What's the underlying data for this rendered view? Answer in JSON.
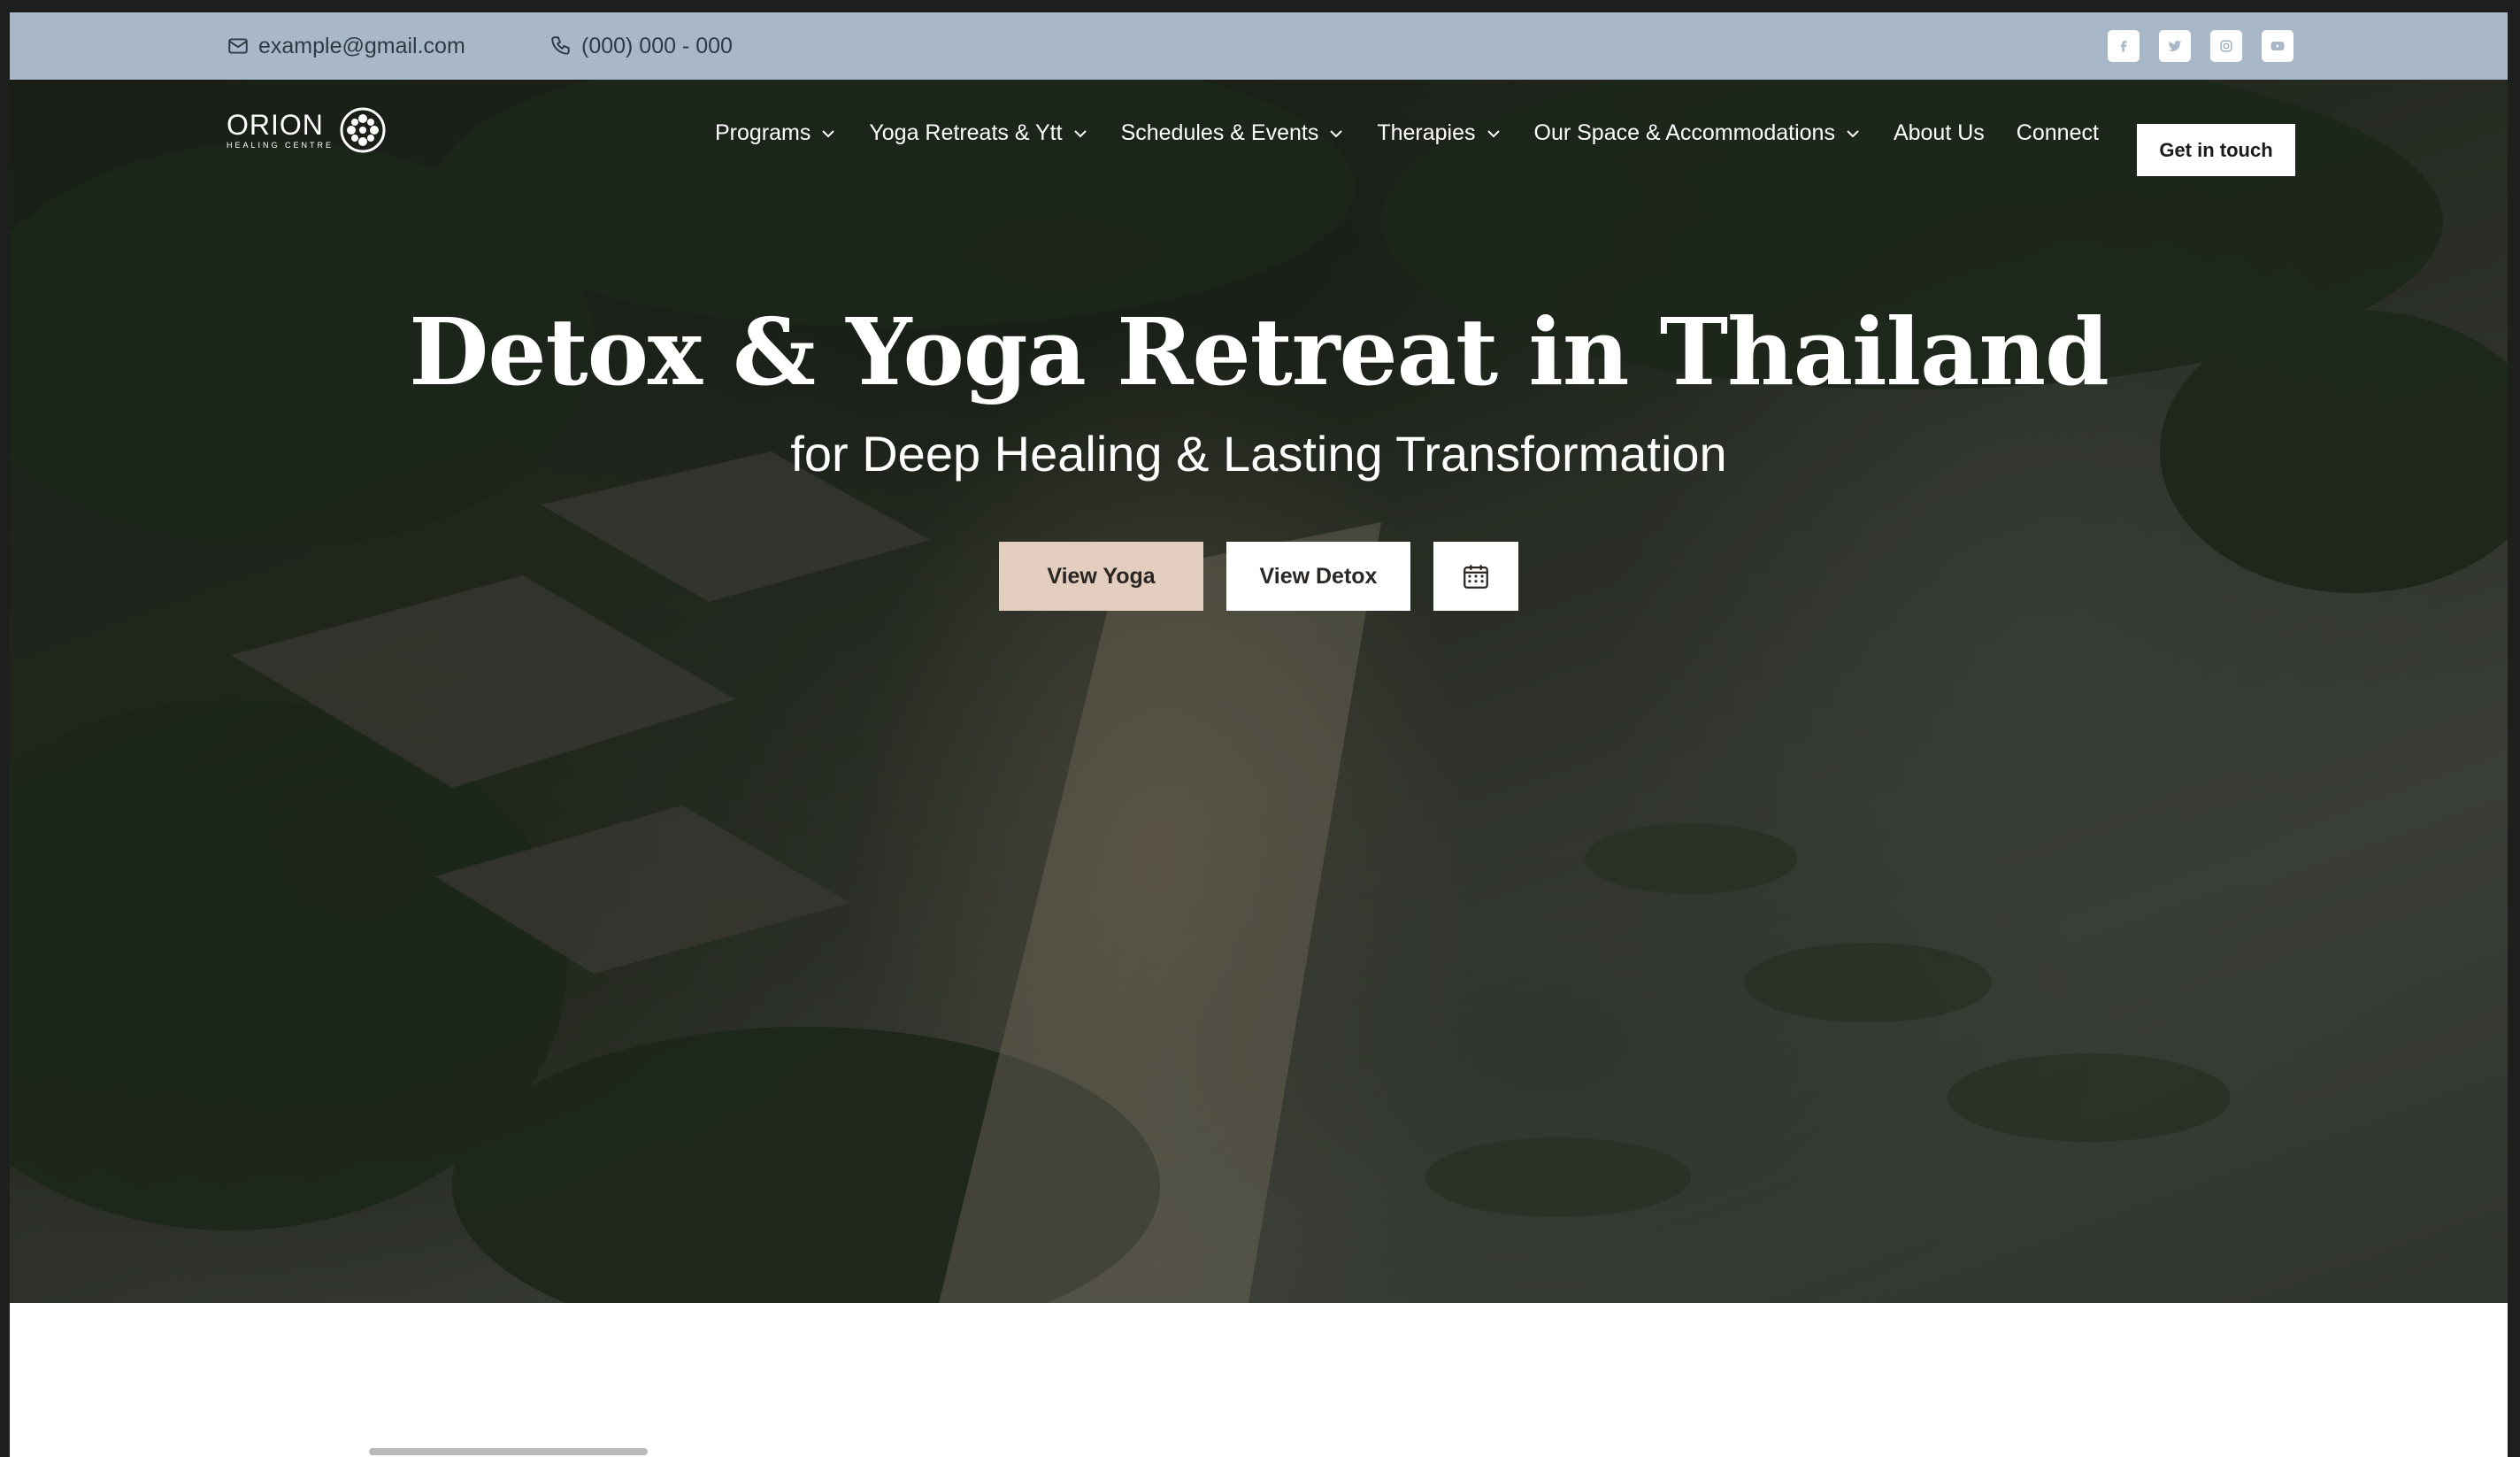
{
  "topbar": {
    "email": "example@gmail.com",
    "phone": "(000) 000 - 000",
    "socials": [
      "facebook-icon",
      "twitter-icon",
      "instagram-icon",
      "youtube-icon"
    ]
  },
  "logo": {
    "brand": "ORION",
    "tagline": "HEALING CENTRE"
  },
  "nav": {
    "items": [
      {
        "label": "Programs",
        "dropdown": true
      },
      {
        "label": "Yoga Retreats & Ytt",
        "dropdown": true
      },
      {
        "label": "Schedules & Events",
        "dropdown": true
      },
      {
        "label": "Therapies",
        "dropdown": true
      },
      {
        "label": "Our Space & Accommodations",
        "dropdown": true
      },
      {
        "label": "About Us",
        "dropdown": false
      },
      {
        "label": "Connect",
        "dropdown": false
      }
    ],
    "cta": "Get in touch"
  },
  "hero": {
    "title": "Detox & Yoga Retreat in Thailand",
    "subtitle": "for Deep Healing & Lasting Transformation",
    "btn_yoga": "View Yoga",
    "btn_detox": "View Detox",
    "btn_calendar_icon": "calendar-icon"
  },
  "colors": {
    "topbar_bg": "#a8b8c8",
    "yoga_btn_bg": "#e3cdbf",
    "white": "#ffffff"
  }
}
